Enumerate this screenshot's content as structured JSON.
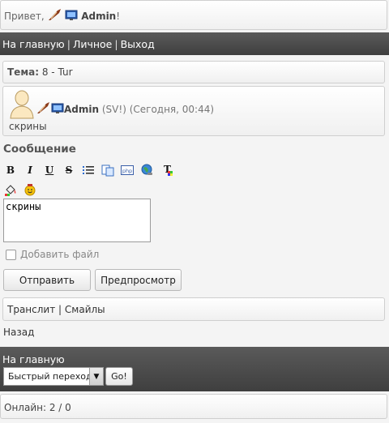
{
  "greeting": {
    "prefix": "Привет,",
    "username": "Admin",
    "suffix": "!"
  },
  "nav": {
    "home": "На главную",
    "personal": "Личное",
    "logout": "Выход",
    "separator": "|"
  },
  "topic": {
    "label": "Тема:",
    "value": "8 - Tur"
  },
  "post": {
    "author": "Admin",
    "meta": "(SV!) (Сегодня, 00:44)",
    "text": "скрины"
  },
  "editor": {
    "label": "Сообщение",
    "toolbar": [
      "bold-icon",
      "italic-icon",
      "underline-icon",
      "strikethrough-icon",
      "list-icon",
      "copy-icon",
      "php-icon",
      "globe-link-icon",
      "text-color-icon",
      "paint-bucket-icon",
      "smiley-icon"
    ],
    "toolbar_letters": {
      "bold": "B",
      "italic": "I",
      "underline": "U",
      "strike": "S",
      "php": "php"
    },
    "message_value": "скрины",
    "attach_label": "Добавить файл",
    "attach_checked": false,
    "submit_label": "Отправить",
    "preview_label": "Предпросмотр"
  },
  "extra_links": {
    "translit": "Транслит",
    "smiles": "Смайлы",
    "separator": "|"
  },
  "back_label": "Назад",
  "footer": {
    "home": "На главную",
    "quick_jump": "Быстрый переход",
    "go_label": "Go!"
  },
  "online": "Онлайн: 2 / 0",
  "colors": {
    "dark_bar": "#4a4a4a",
    "panel_border": "#cfcfcf",
    "text": "#333333"
  }
}
